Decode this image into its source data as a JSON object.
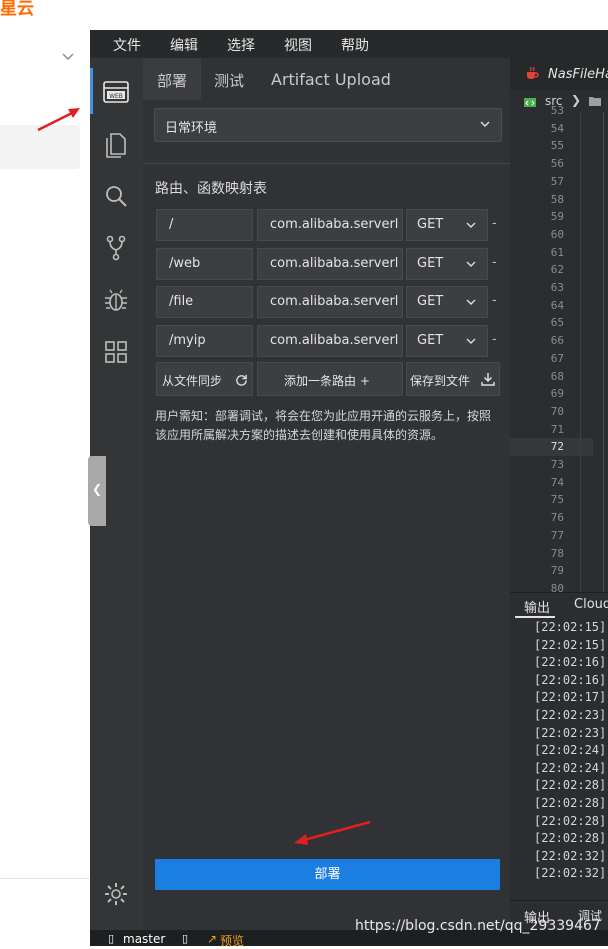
{
  "brand": {
    "text": "星云"
  },
  "menu": [
    "文件",
    "编辑",
    "选择",
    "视图",
    "帮助"
  ],
  "panel": {
    "tabs": [
      "部署",
      "测试",
      "Artifact Upload"
    ],
    "environment": "日常环境",
    "route_table_title": "路由、函数映射表",
    "routes": [
      {
        "path": "/",
        "function": "com.alibaba.serverl",
        "method": "GET"
      },
      {
        "path": "/web",
        "function": "com.alibaba.serverl",
        "method": "GET"
      },
      {
        "path": "/file",
        "function": "com.alibaba.serverl",
        "method": "GET"
      },
      {
        "path": "/myip",
        "function": "com.alibaba.serverl",
        "method": "GET"
      }
    ],
    "buttons": {
      "sync": "从文件同步",
      "add_route": "添加一条路由 +",
      "save_to_file": "保存到文件"
    },
    "notice": "用户需知：部署调试，将会在您为此应用开通的云服务上，按照该应用所属解决方案的描述去创建和使用具体的资源。",
    "deploy_button": "部署"
  },
  "editor": {
    "file_tab": "NasFileHa",
    "breadcrumb": "src",
    "line_numbers": [
      "53",
      "54",
      "55",
      "56",
      "57",
      "58",
      "59",
      "60",
      "61",
      "62",
      "63",
      "64",
      "65",
      "66",
      "67",
      "68",
      "69",
      "70",
      "71",
      "72",
      "73",
      "74",
      "75",
      "76",
      "77",
      "78",
      "79",
      "80"
    ],
    "active_line": "72"
  },
  "output": {
    "tabs": [
      "输出",
      "Cloud"
    ],
    "logs": [
      "[22:02:15]",
      "[22:02:15]",
      "[22:02:16]",
      "[22:02:16]",
      "[22:02:17]",
      "[22:02:23]",
      "[22:02:23]",
      "[22:02:24]",
      "[22:02:24]",
      "[22:02:28]",
      "[22:02:28]",
      "[22:02:28]",
      "[22:02:28]",
      "[22:02:32]",
      "[22:02:32]"
    ]
  },
  "bottom_tabs": [
    "输出",
    "调试"
  ],
  "status": {
    "branch": "master",
    "preview": "预览"
  },
  "watermark": "https://blog.csdn.net/qq_29339467",
  "colors": {
    "accent": "#1c7ee0",
    "brand": "#ff6a00",
    "annotation_arrow": "#e02020"
  }
}
